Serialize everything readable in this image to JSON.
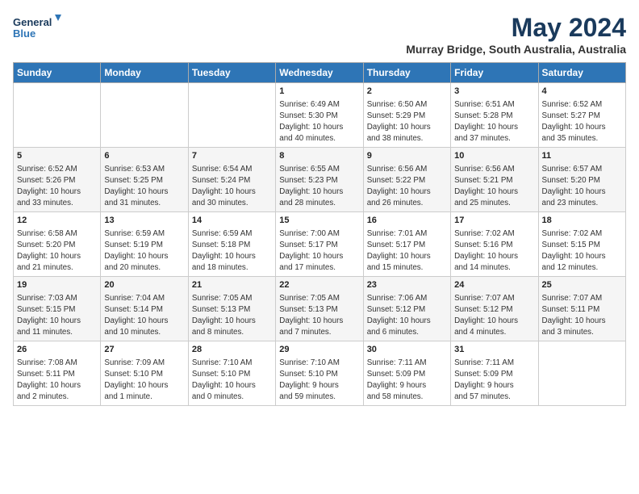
{
  "header": {
    "logo_line1": "General",
    "logo_line2": "Blue",
    "title": "May 2024",
    "subtitle": "Murray Bridge, South Australia, Australia"
  },
  "days_of_week": [
    "Sunday",
    "Monday",
    "Tuesday",
    "Wednesday",
    "Thursday",
    "Friday",
    "Saturday"
  ],
  "weeks": [
    [
      {
        "day": "",
        "info": ""
      },
      {
        "day": "",
        "info": ""
      },
      {
        "day": "",
        "info": ""
      },
      {
        "day": "1",
        "info": "Sunrise: 6:49 AM\nSunset: 5:30 PM\nDaylight: 10 hours\nand 40 minutes."
      },
      {
        "day": "2",
        "info": "Sunrise: 6:50 AM\nSunset: 5:29 PM\nDaylight: 10 hours\nand 38 minutes."
      },
      {
        "day": "3",
        "info": "Sunrise: 6:51 AM\nSunset: 5:28 PM\nDaylight: 10 hours\nand 37 minutes."
      },
      {
        "day": "4",
        "info": "Sunrise: 6:52 AM\nSunset: 5:27 PM\nDaylight: 10 hours\nand 35 minutes."
      }
    ],
    [
      {
        "day": "5",
        "info": "Sunrise: 6:52 AM\nSunset: 5:26 PM\nDaylight: 10 hours\nand 33 minutes."
      },
      {
        "day": "6",
        "info": "Sunrise: 6:53 AM\nSunset: 5:25 PM\nDaylight: 10 hours\nand 31 minutes."
      },
      {
        "day": "7",
        "info": "Sunrise: 6:54 AM\nSunset: 5:24 PM\nDaylight: 10 hours\nand 30 minutes."
      },
      {
        "day": "8",
        "info": "Sunrise: 6:55 AM\nSunset: 5:23 PM\nDaylight: 10 hours\nand 28 minutes."
      },
      {
        "day": "9",
        "info": "Sunrise: 6:56 AM\nSunset: 5:22 PM\nDaylight: 10 hours\nand 26 minutes."
      },
      {
        "day": "10",
        "info": "Sunrise: 6:56 AM\nSunset: 5:21 PM\nDaylight: 10 hours\nand 25 minutes."
      },
      {
        "day": "11",
        "info": "Sunrise: 6:57 AM\nSunset: 5:20 PM\nDaylight: 10 hours\nand 23 minutes."
      }
    ],
    [
      {
        "day": "12",
        "info": "Sunrise: 6:58 AM\nSunset: 5:20 PM\nDaylight: 10 hours\nand 21 minutes."
      },
      {
        "day": "13",
        "info": "Sunrise: 6:59 AM\nSunset: 5:19 PM\nDaylight: 10 hours\nand 20 minutes."
      },
      {
        "day": "14",
        "info": "Sunrise: 6:59 AM\nSunset: 5:18 PM\nDaylight: 10 hours\nand 18 minutes."
      },
      {
        "day": "15",
        "info": "Sunrise: 7:00 AM\nSunset: 5:17 PM\nDaylight: 10 hours\nand 17 minutes."
      },
      {
        "day": "16",
        "info": "Sunrise: 7:01 AM\nSunset: 5:17 PM\nDaylight: 10 hours\nand 15 minutes."
      },
      {
        "day": "17",
        "info": "Sunrise: 7:02 AM\nSunset: 5:16 PM\nDaylight: 10 hours\nand 14 minutes."
      },
      {
        "day": "18",
        "info": "Sunrise: 7:02 AM\nSunset: 5:15 PM\nDaylight: 10 hours\nand 12 minutes."
      }
    ],
    [
      {
        "day": "19",
        "info": "Sunrise: 7:03 AM\nSunset: 5:15 PM\nDaylight: 10 hours\nand 11 minutes."
      },
      {
        "day": "20",
        "info": "Sunrise: 7:04 AM\nSunset: 5:14 PM\nDaylight: 10 hours\nand 10 minutes."
      },
      {
        "day": "21",
        "info": "Sunrise: 7:05 AM\nSunset: 5:13 PM\nDaylight: 10 hours\nand 8 minutes."
      },
      {
        "day": "22",
        "info": "Sunrise: 7:05 AM\nSunset: 5:13 PM\nDaylight: 10 hours\nand 7 minutes."
      },
      {
        "day": "23",
        "info": "Sunrise: 7:06 AM\nSunset: 5:12 PM\nDaylight: 10 hours\nand 6 minutes."
      },
      {
        "day": "24",
        "info": "Sunrise: 7:07 AM\nSunset: 5:12 PM\nDaylight: 10 hours\nand 4 minutes."
      },
      {
        "day": "25",
        "info": "Sunrise: 7:07 AM\nSunset: 5:11 PM\nDaylight: 10 hours\nand 3 minutes."
      }
    ],
    [
      {
        "day": "26",
        "info": "Sunrise: 7:08 AM\nSunset: 5:11 PM\nDaylight: 10 hours\nand 2 minutes."
      },
      {
        "day": "27",
        "info": "Sunrise: 7:09 AM\nSunset: 5:10 PM\nDaylight: 10 hours\nand 1 minute."
      },
      {
        "day": "28",
        "info": "Sunrise: 7:10 AM\nSunset: 5:10 PM\nDaylight: 10 hours\nand 0 minutes."
      },
      {
        "day": "29",
        "info": "Sunrise: 7:10 AM\nSunset: 5:10 PM\nDaylight: 9 hours\nand 59 minutes."
      },
      {
        "day": "30",
        "info": "Sunrise: 7:11 AM\nSunset: 5:09 PM\nDaylight: 9 hours\nand 58 minutes."
      },
      {
        "day": "31",
        "info": "Sunrise: 7:11 AM\nSunset: 5:09 PM\nDaylight: 9 hours\nand 57 minutes."
      },
      {
        "day": "",
        "info": ""
      }
    ]
  ]
}
